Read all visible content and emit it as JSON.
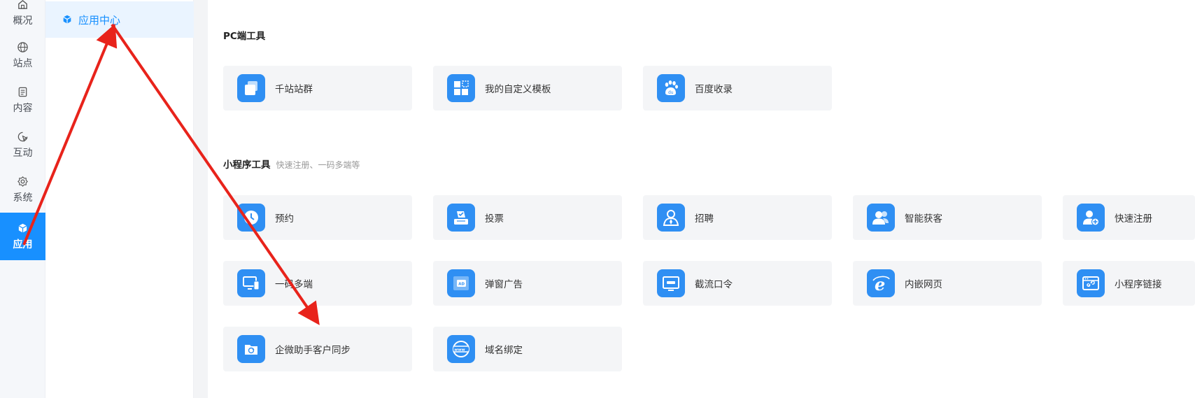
{
  "rail": {
    "items": [
      {
        "label": "概况",
        "icon": "home-icon"
      },
      {
        "label": "站点",
        "icon": "globe-icon"
      },
      {
        "label": "内容",
        "icon": "document-icon"
      },
      {
        "label": "互动",
        "icon": "interaction-icon"
      },
      {
        "label": "系统",
        "icon": "gear-icon"
      },
      {
        "label": "应用",
        "icon": "cube-icon",
        "active": true
      }
    ]
  },
  "submenu": {
    "active_label": "应用中心"
  },
  "sections": {
    "pc": {
      "title": "PC端工具",
      "cards": [
        {
          "label": "千站站群",
          "icon": "copy-stack-icon"
        },
        {
          "label": "我的自定义模板",
          "icon": "template-grid-icon"
        },
        {
          "label": "百度收录",
          "icon": "baidu-paw-icon"
        }
      ]
    },
    "mini": {
      "title": "小程序工具",
      "subtitle": "快速注册、一码多端等",
      "cards": [
        {
          "label": "预约",
          "icon": "clock-icon"
        },
        {
          "label": "投票",
          "icon": "vote-box-icon"
        },
        {
          "label": "招聘",
          "icon": "recruit-person-icon"
        },
        {
          "label": "智能获客",
          "icon": "users-icon"
        },
        {
          "label": "快速注册",
          "icon": "user-add-icon"
        },
        {
          "label": "一码多端",
          "icon": "multi-device-icon"
        },
        {
          "label": "弹窗广告",
          "icon": "popup-ad-icon"
        },
        {
          "label": "截流口令",
          "icon": "code-screen-icon"
        },
        {
          "label": "内嵌网页",
          "icon": "ie-browser-icon"
        },
        {
          "label": "小程序链接",
          "icon": "link-window-icon"
        },
        {
          "label": "企微助手客户同步",
          "icon": "folder-sync-icon"
        },
        {
          "label": "域名绑定",
          "icon": "www-globe-icon"
        }
      ]
    }
  },
  "colors": {
    "accent": "#1890ff",
    "icon_bg": "#2f8ff3",
    "card_bg": "#f4f5f7",
    "annotation": "#e8231b"
  }
}
